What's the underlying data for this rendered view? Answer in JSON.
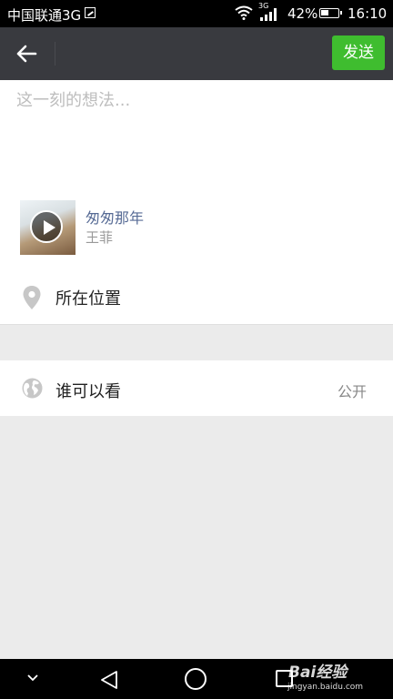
{
  "status_bar": {
    "carrier": "中国联通3G",
    "network_type": "3G",
    "battery_percent": "42%",
    "time": "16:10"
  },
  "app_bar": {
    "send_label": "发送"
  },
  "compose": {
    "placeholder": "这一刻的想法...",
    "value": ""
  },
  "music": {
    "title": "匆匆那年",
    "artist": "王菲"
  },
  "location": {
    "label": "所在位置"
  },
  "visibility": {
    "label": "谁可以看",
    "value": "公开"
  },
  "watermark": {
    "logo_text": "Bai经验",
    "url": "jingyan.baidu.com"
  },
  "icons": {
    "back": "arrow-left-icon",
    "location": "map-pin-icon",
    "visibility": "globe-icon",
    "play": "play-icon"
  },
  "colors": {
    "app_bar": "#393a3f",
    "send_button": "#3fbd2f",
    "link_blue": "#576b95",
    "background": "#ebebeb"
  }
}
